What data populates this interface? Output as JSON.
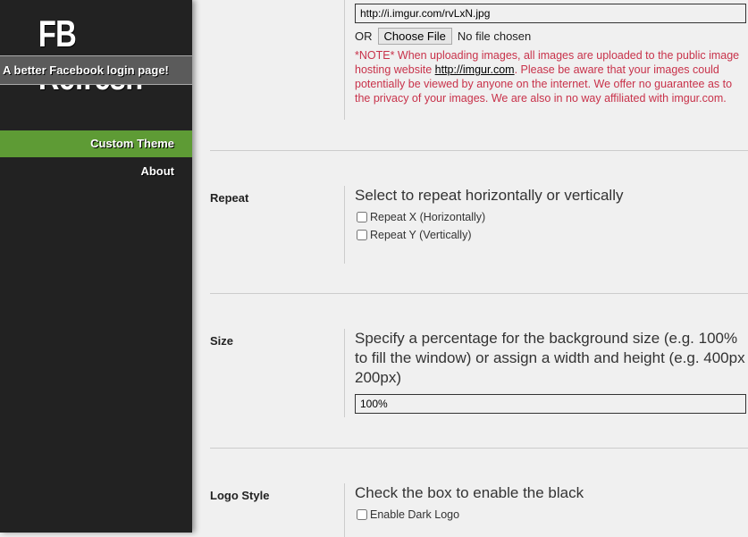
{
  "sidebar": {
    "title": "FB Refresh",
    "tagline": "A better Facebook login page!",
    "items": [
      {
        "label": "Custom Theme",
        "active": true
      },
      {
        "label": "About",
        "active": false
      }
    ],
    "accent": "#5e9b35"
  },
  "background": {
    "url_value": "http://i.imgur.com/rvLxN.jpg",
    "or_label": "OR",
    "choose_file": "Choose File",
    "no_file": "No file chosen",
    "note_before": "*NOTE* When uploading images, all images are uploaded to the public image hosting website ",
    "note_link": "http://imgur.com",
    "note_after": ". Please be aware that your images could potentially be viewed by anyone on the internet. We offer no guarantee as to the privacy of your images. We are also in no way affiliated with imgur.com."
  },
  "repeat": {
    "label": "Repeat",
    "description": "Select to repeat horizontally or vertically",
    "options": [
      {
        "label": "Repeat X (Horizontally)",
        "checked": false
      },
      {
        "label": "Repeat Y (Vertically)",
        "checked": false
      }
    ]
  },
  "size": {
    "label": "Size",
    "description": "Specify a percentage for the background size (e.g. 100% to fill the window) or assign a width and height (e.g. 400px 200px)",
    "value": "100%"
  },
  "logo": {
    "label": "Logo Style",
    "description": "Check the box to enable the black",
    "option": "Enable Dark Logo",
    "checked": false
  }
}
